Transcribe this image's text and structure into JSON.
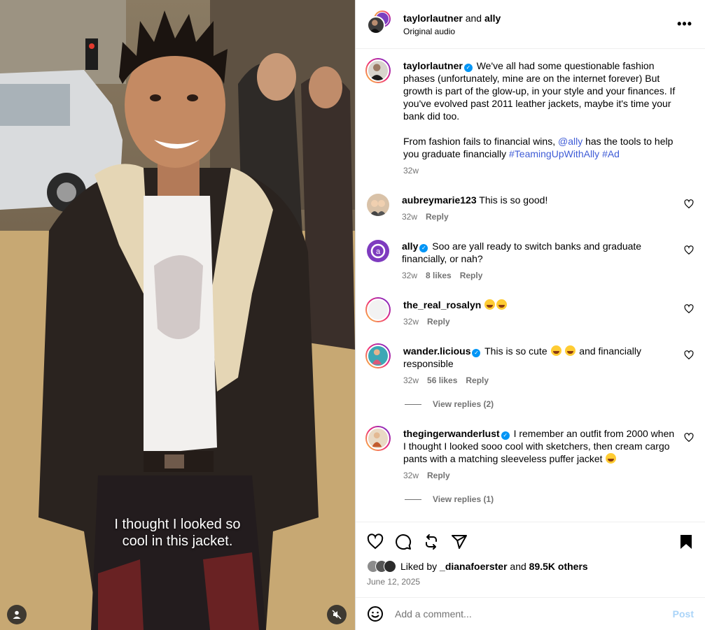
{
  "media": {
    "caption_line1": "I thought I looked so",
    "caption_line2": "cool in this jacket."
  },
  "header": {
    "user1": "taylorlautner",
    "and": "and",
    "user2": "ally",
    "audio": "Original audio"
  },
  "post_caption": {
    "username": "taylorlautner",
    "text1": "We've all had some questionable fashion phases (unfortunately, mine are on the internet forever) But growth is part of the glow-up, in your style and your finances. If you've evolved past 2011 leather jackets, maybe it's time your bank did too.",
    "text2a": "From fashion fails to financial wins,",
    "mention": "@ally",
    "text2b": "has the tools to help you graduate financially",
    "hashtag1": "#TeamingUpWithAlly",
    "hashtag2": "#Ad",
    "time": "32w"
  },
  "comments": [
    {
      "username": "aubreymarie123",
      "text": "This is so good!",
      "time": "32w",
      "likes": "",
      "reply": "Reply"
    },
    {
      "username": "ally",
      "text": "Soo are yall ready to switch banks and graduate financially, or nah?",
      "time": "32w",
      "likes": "8 likes",
      "reply": "Reply"
    },
    {
      "username": "the_real_rosalyn",
      "text": "",
      "time": "32w",
      "likes": "",
      "reply": "Reply"
    },
    {
      "username": "wander.licious",
      "text_a": "This is so cute",
      "text_b": "and financially responsible",
      "time": "32w",
      "likes": "56 likes",
      "reply": "Reply",
      "view_replies": "View replies (2)"
    },
    {
      "username": "thegingerwanderlust",
      "text": "I remember an outfit from 2000 when I thought I looked sooo cool with sketchers, then cream cargo pants with a matching sleeveless puffer jacket",
      "time": "32w",
      "likes": "",
      "reply": "Reply",
      "view_replies": "View replies (1)"
    }
  ],
  "likes_summary": {
    "prefix": "Liked by",
    "user": "_dianafoerster",
    "and": "and",
    "count": "89.5K others"
  },
  "date": "June 12, 2025",
  "composer": {
    "placeholder": "Add a comment...",
    "post_label": "Post"
  },
  "colors": {
    "link": "#3f5cd6",
    "verified": "#0095f6",
    "post_disabled": "#aad4f8"
  }
}
